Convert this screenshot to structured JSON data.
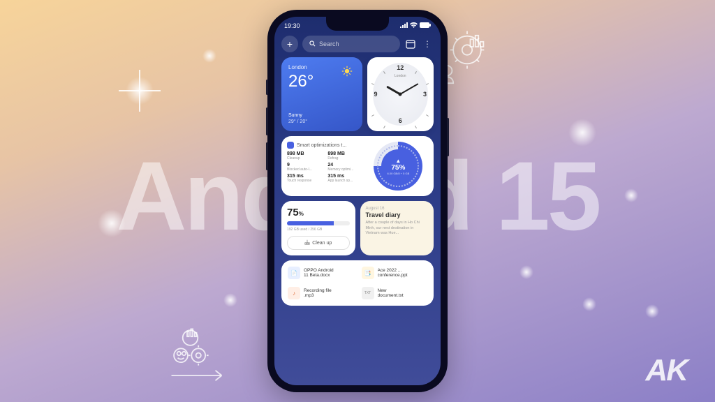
{
  "bg_text": "Android 15",
  "logo": "AK",
  "status": {
    "time": "19:30"
  },
  "search": {
    "placeholder": "Search"
  },
  "weather": {
    "city": "London",
    "temp": "26°",
    "condition": "Sunny",
    "range": "29° / 20°"
  },
  "clock": {
    "label": "London",
    "n12": "12",
    "n3": "3",
    "n6": "6",
    "n9": "9"
  },
  "optimization": {
    "title": "Smart optimizations t...",
    "stats": [
      {
        "val": "898 MB",
        "lbl": "Cleanup"
      },
      {
        "val": "898 MB",
        "lbl": "Defrag"
      },
      {
        "val": "9",
        "lbl": "Blocked auto-l..."
      },
      {
        "val": "24",
        "lbl": "Memory optimi..."
      },
      {
        "val": "315 ms",
        "lbl": "Touch response"
      },
      {
        "val": "315 ms",
        "lbl": "App launch sp..."
      }
    ],
    "circle_pct": "75%",
    "circle_sub": "6.00 GB/8 + 5 GB"
  },
  "storage": {
    "pct": "75",
    "pct_sign": "%",
    "detail": "192 GB used / 256 GB",
    "clean_label": "Clean up"
  },
  "note": {
    "date": "August 16",
    "title": "Travel diary",
    "body": "After a couple of days in Ho Chi Minh, our next destination in Vietnam was Hue..."
  },
  "files": [
    {
      "line1": "OPPO Android",
      "line2": "11 Beta.docx",
      "icon": "doc"
    },
    {
      "line1": "Ace 2022 ...",
      "line2": "conference.ppt",
      "icon": "ppt"
    },
    {
      "line1": "Recording file",
      "line2": ".mp3",
      "icon": "mp3"
    },
    {
      "line1": "New",
      "line2": "document.txt",
      "icon": "txt"
    }
  ]
}
